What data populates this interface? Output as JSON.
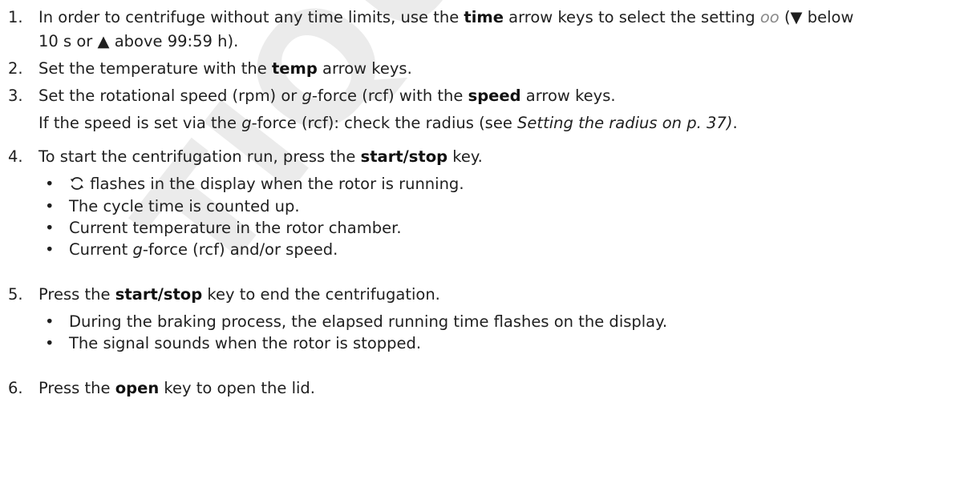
{
  "watermark": "TIQUE DUPLI",
  "steps": [
    {
      "num": "1.",
      "line1": {
        "pre": "In order to centrifuge without any time limits, use the ",
        "bold": "time",
        "post": " arrow keys to select the setting ",
        "setting": "oo",
        "tail": " (▼ below"
      },
      "line2": "10 s or ▲ above 99:59 h)."
    },
    {
      "num": "2.",
      "pre": "Set the temperature with the ",
      "bold": "temp",
      "post": " arrow keys."
    },
    {
      "num": "3.",
      "pre": "Set the rotational speed (rpm) or ",
      "g": "g",
      "mid": "-force (rcf) with the ",
      "bold": "speed",
      "post": " arrow keys.",
      "note": {
        "pre": "If the speed is set via the ",
        "g": "g",
        "mid": "-force (rcf): check the radius (see ",
        "ref": "Setting the radius on p. 37)",
        "post": "."
      }
    },
    {
      "num": "4.",
      "pre": "To start the centrifugation run, press the ",
      "bold": "start/stop",
      "post": " key.",
      "bullets": [
        {
          "text": " flashes in the display when the rotor is running.",
          "icon": "rotate-icon"
        },
        {
          "text": "The cycle time is counted up."
        },
        {
          "text": "Current temperature in the rotor chamber."
        },
        {
          "pre": "Current ",
          "g": "g",
          "post": "-force (rcf) and/or speed."
        }
      ]
    },
    {
      "num": "5.",
      "pre": "Press the ",
      "bold": "start/stop",
      "post": " key to end the centrifugation.",
      "bullets": [
        {
          "text": "During the braking process, the elapsed running time flashes on the display."
        },
        {
          "text": "The signal sounds when the rotor is stopped."
        }
      ]
    },
    {
      "num": "6.",
      "pre": "Press the ",
      "bold": "open",
      "post": " key to open the lid."
    }
  ],
  "bullet_char": "•"
}
